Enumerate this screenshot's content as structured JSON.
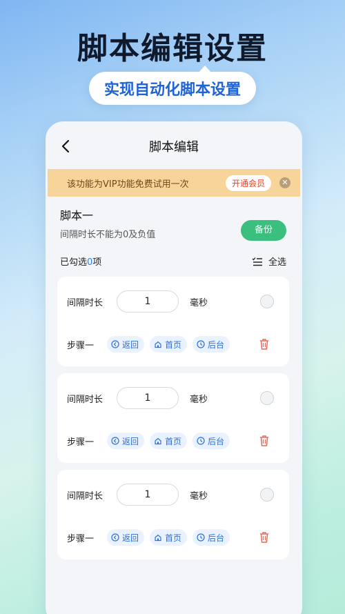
{
  "hero": {
    "title": "脚本编辑设置",
    "subtitle": "实现自动化脚本设置"
  },
  "nav": {
    "back_icon": "chevron-left-icon",
    "title": "脚本编辑"
  },
  "vip_banner": {
    "text": "该功能为VIP功能免费试用一次",
    "button": "开通会员",
    "close_icon": "close-icon"
  },
  "script": {
    "name": "脚本一",
    "hint": "间隔时长不能为0及负值",
    "backup_button": "备份",
    "selected_prefix": "已勾选",
    "selected_count": "0",
    "selected_suffix": "项",
    "select_all": "全选"
  },
  "steps": [
    {
      "interval_label": "间隔时长",
      "interval_value": "1",
      "unit": "毫秒",
      "step_label": "步骤一",
      "actions": [
        "返回",
        "首页",
        "后台"
      ]
    },
    {
      "interval_label": "间隔时长",
      "interval_value": "1",
      "unit": "毫秒",
      "step_label": "步骤一",
      "actions": [
        "返回",
        "首页",
        "后台"
      ]
    },
    {
      "interval_label": "间隔时长",
      "interval_value": "1",
      "unit": "毫秒",
      "step_label": "步骤一",
      "actions": [
        "返回",
        "首页",
        "后台"
      ]
    }
  ],
  "colors": {
    "accent_blue": "#2a6fdc",
    "backup_green": "#3bbf7e",
    "vip_bg": "#f7d49a",
    "trash_red": "#e86a5a"
  }
}
